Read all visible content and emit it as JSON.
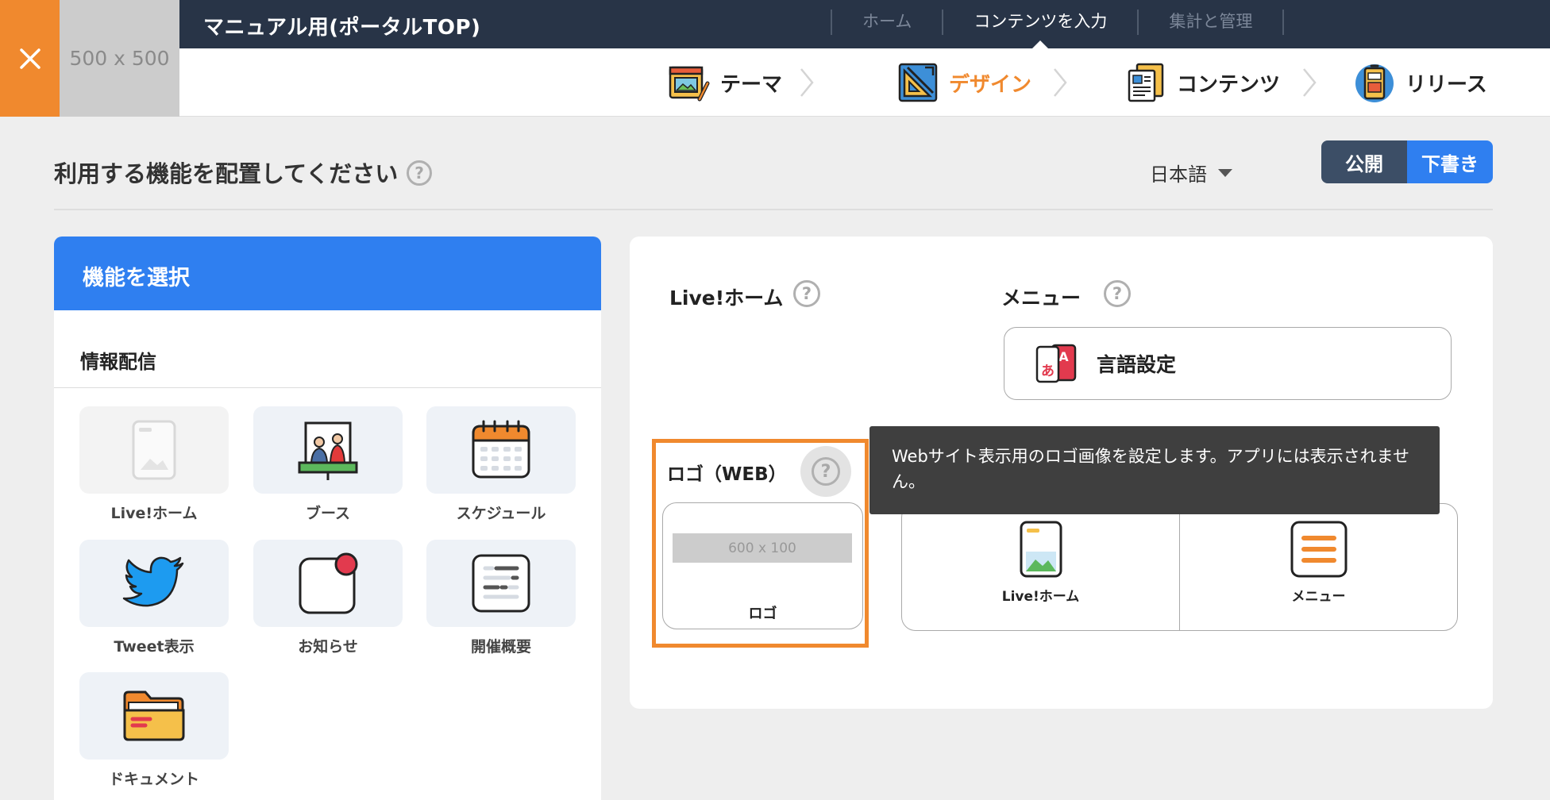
{
  "window": {
    "close_icon": "close-icon",
    "logo_placeholder": "500 x 500"
  },
  "header": {
    "title": "マニュアル用(ポータルTOP)",
    "nav": [
      "ホーム",
      "コンテンツを入力",
      "集計と管理"
    ],
    "nav_active": "コンテンツを入力"
  },
  "steps": [
    {
      "label": "テーマ",
      "icon": "theme-icon"
    },
    {
      "label": "デザイン",
      "icon": "design-icon",
      "active": true
    },
    {
      "label": "コンテンツ",
      "icon": "contents-icon"
    },
    {
      "label": "リリース",
      "icon": "release-icon"
    }
  ],
  "page": {
    "heading": "利用する機能を配置してください",
    "help_glyph": "?",
    "language": "日本語",
    "publish_label": "公開",
    "draft_label": "下書き",
    "draft_active": true
  },
  "feature_panel": {
    "title": "機能を選択",
    "section": "情報配信",
    "tiles": [
      {
        "label": "Live!ホーム",
        "icon": "phone-image-icon",
        "disabled": true
      },
      {
        "label": "ブース",
        "icon": "booth-icon"
      },
      {
        "label": "スケジュール",
        "icon": "calendar-icon"
      },
      {
        "label": "Tweet表示",
        "icon": "twitter-bird-icon"
      },
      {
        "label": "お知らせ",
        "icon": "notification-icon"
      },
      {
        "label": "開催概要",
        "icon": "overview-list-icon"
      },
      {
        "label": "ドキュメント",
        "icon": "folder-icon"
      }
    ]
  },
  "layout_panel": {
    "live_home_title": "Live!ホーム",
    "menu_title": "メニュー",
    "language_setting_label": "言語設定",
    "logo_title": "ロゴ（WEB）",
    "logo_placeholder": "600 x 100",
    "logo_card_label": "ロゴ",
    "footer_items": [
      {
        "label": "Live!ホーム",
        "icon": "phone-image-icon"
      },
      {
        "label": "メニュー",
        "icon": "hamburger-menu-icon"
      }
    ]
  },
  "tooltip": {
    "text": "Webサイト表示用のロゴ画像を設定します。アプリには表示されません。"
  },
  "colors": {
    "accent_orange": "#f0892e",
    "primary_blue": "#2f7ff0",
    "topbar_navy": "#283447",
    "publish_navy": "#3c4e66"
  }
}
